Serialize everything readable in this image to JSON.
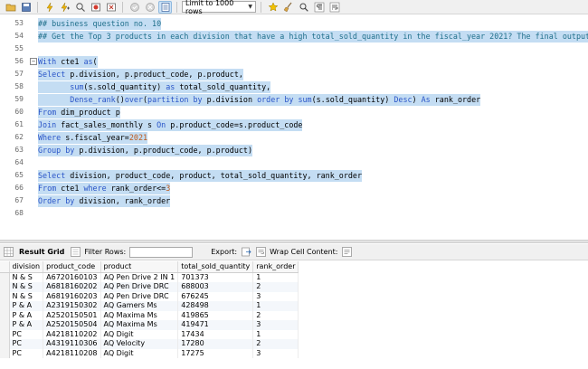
{
  "toolbar": {
    "limit_label": "Limit to 1000 rows",
    "icons": [
      "folder-icon",
      "save-icon",
      "execute-icon",
      "execute-current-icon",
      "explain-icon",
      "stop-icon",
      "toggle-error-icon",
      "commit-icon",
      "rollback-icon",
      "autocommit-icon",
      "beautify-icon",
      "find-icon",
      "invisible-chars-icon",
      "wrap-icon"
    ]
  },
  "editor": {
    "lines": [
      {
        "n": "53",
        "segments": [
          {
            "t": "## business question no. 10",
            "c": "cm"
          }
        ]
      },
      {
        "n": "54",
        "segments": [
          {
            "t": "## Get the Top 3 products in each division that have a high total_sold_quantity in the fiscal_year 2021? The final output conta",
            "c": "cm"
          }
        ]
      },
      {
        "n": "55",
        "segments": []
      },
      {
        "n": "56",
        "segments": [
          {
            "t": "With",
            "c": "kw"
          },
          {
            "t": " cte1 ",
            "c": "pl"
          },
          {
            "t": "as",
            "c": "kw"
          },
          {
            "t": "(",
            "c": "pl"
          }
        ]
      },
      {
        "n": "57",
        "segments": [
          {
            "t": "Select",
            "c": "kw"
          },
          {
            "t": " p.division, p.product_code, p.product,",
            "c": "pl"
          }
        ]
      },
      {
        "n": "58",
        "segments": [
          {
            "t": "       sum",
            "c": "fn"
          },
          {
            "t": "(s.sold_quantity) ",
            "c": "pl"
          },
          {
            "t": "as",
            "c": "kw"
          },
          {
            "t": " total_sold_quantity,",
            "c": "pl"
          }
        ]
      },
      {
        "n": "59",
        "segments": [
          {
            "t": "       Dense_rank",
            "c": "fn"
          },
          {
            "t": "()",
            "c": "pl"
          },
          {
            "t": "over",
            "c": "kw"
          },
          {
            "t": "(",
            "c": "pl"
          },
          {
            "t": "partition by",
            "c": "kw"
          },
          {
            "t": " p.division ",
            "c": "pl"
          },
          {
            "t": "order by",
            "c": "kw"
          },
          {
            "t": " ",
            "c": "pl"
          },
          {
            "t": "sum",
            "c": "fn"
          },
          {
            "t": "(s.sold_quantity) ",
            "c": "pl"
          },
          {
            "t": "Desc",
            "c": "kw"
          },
          {
            "t": ") ",
            "c": "pl"
          },
          {
            "t": "As",
            "c": "kw"
          },
          {
            "t": " rank_order",
            "c": "pl"
          }
        ]
      },
      {
        "n": "60",
        "segments": [
          {
            "t": "From",
            "c": "kw"
          },
          {
            "t": " dim_product p",
            "c": "pl"
          }
        ]
      },
      {
        "n": "61",
        "segments": [
          {
            "t": "Join",
            "c": "kw"
          },
          {
            "t": " fact_sales_monthly s ",
            "c": "pl"
          },
          {
            "t": "On",
            "c": "kw"
          },
          {
            "t": " p.product_code=s.product_code",
            "c": "pl"
          }
        ]
      },
      {
        "n": "62",
        "segments": [
          {
            "t": "Where",
            "c": "kw"
          },
          {
            "t": " s.fiscal_year=",
            "c": "pl"
          },
          {
            "t": "2021",
            "c": "num"
          }
        ]
      },
      {
        "n": "63",
        "segments": [
          {
            "t": "Group by",
            "c": "kw"
          },
          {
            "t": " p.division, p.product_code, p.product)",
            "c": "pl"
          }
        ]
      },
      {
        "n": "64",
        "segments": []
      },
      {
        "n": "65",
        "segments": [
          {
            "t": "Select",
            "c": "kw"
          },
          {
            "t": " division, product_code, product, total_sold_quantity, rank_order",
            "c": "pl"
          }
        ]
      },
      {
        "n": "66",
        "segments": [
          {
            "t": "From",
            "c": "kw"
          },
          {
            "t": " cte1 ",
            "c": "pl"
          },
          {
            "t": "where",
            "c": "kw"
          },
          {
            "t": " rank_order<=",
            "c": "pl"
          },
          {
            "t": "3",
            "c": "num"
          }
        ]
      },
      {
        "n": "67",
        "segments": [
          {
            "t": "Order by",
            "c": "kw"
          },
          {
            "t": " division, rank_order",
            "c": "pl"
          }
        ]
      },
      {
        "n": "68",
        "segments": []
      }
    ]
  },
  "results": {
    "tab_label": "Result Grid",
    "filter_label": "Filter Rows:",
    "export_label": "Export:",
    "wrap_label": "Wrap Cell Content:",
    "columns": [
      "division",
      "product_code",
      "product",
      "total_sold_quantity",
      "rank_order"
    ],
    "rows": [
      [
        "N & S",
        "A6720160103",
        "AQ Pen Drive 2 IN 1",
        "701373",
        "1"
      ],
      [
        "N & S",
        "A6818160202",
        "AQ Pen Drive DRC",
        "688003",
        "2"
      ],
      [
        "N & S",
        "A6819160203",
        "AQ Pen Drive DRC",
        "676245",
        "3"
      ],
      [
        "P & A",
        "A2319150302",
        "AQ Gamers Ms",
        "428498",
        "1"
      ],
      [
        "P & A",
        "A2520150501",
        "AQ Maxima Ms",
        "419865",
        "2"
      ],
      [
        "P & A",
        "A2520150504",
        "AQ Maxima Ms",
        "419471",
        "3"
      ],
      [
        "PC",
        "A4218110202",
        "AQ Digit",
        "17434",
        "1"
      ],
      [
        "PC",
        "A4319110306",
        "AQ Velocity",
        "17280",
        "2"
      ],
      [
        "PC",
        "A4218110208",
        "AQ Digit",
        "17275",
        "3"
      ]
    ]
  },
  "colors": {
    "keyword": "#2a55c8",
    "comment": "#1f6f8b",
    "number": "#c05a1a",
    "selection": "#c4ddf3"
  }
}
